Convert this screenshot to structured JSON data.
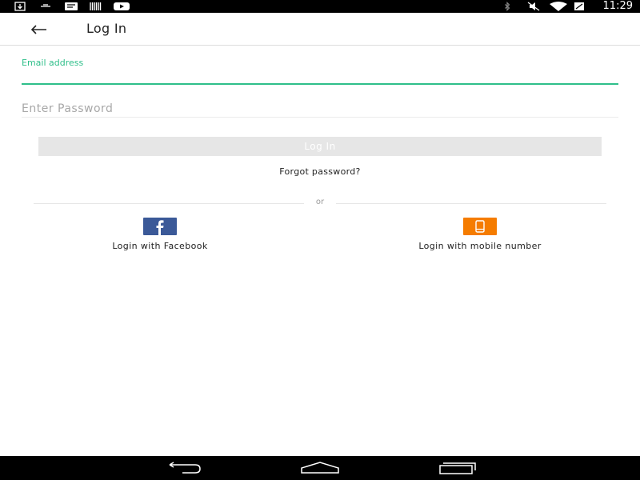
{
  "status_bar": {
    "time": "11:29",
    "left_icons": [
      "download-icon",
      "voicemail-icon",
      "message-icon",
      "barcode-icon",
      "youtube-icon"
    ],
    "right_icons": [
      "bluetooth-icon",
      "mute-icon",
      "wifi-icon",
      "battery-icon"
    ]
  },
  "app_bar": {
    "title": "Log In",
    "back_icon": "arrow-left-icon"
  },
  "form": {
    "email_label": "Email address",
    "email_value": "",
    "password_placeholder": "Enter Password",
    "login_label": "Log In",
    "forgot_label": "Forgot password?"
  },
  "divider": {
    "text": "or"
  },
  "social": {
    "facebook_label": "Login with Facebook",
    "mobile_label": "Login with mobile number"
  },
  "colors": {
    "accent": "#2fbf8a",
    "facebook": "#3b5998",
    "mobile": "#f57c00",
    "disabled_button": "#e6e6e6"
  },
  "nav_bar": {
    "icons": [
      "back-nav-icon",
      "home-nav-icon",
      "recents-nav-icon"
    ]
  }
}
